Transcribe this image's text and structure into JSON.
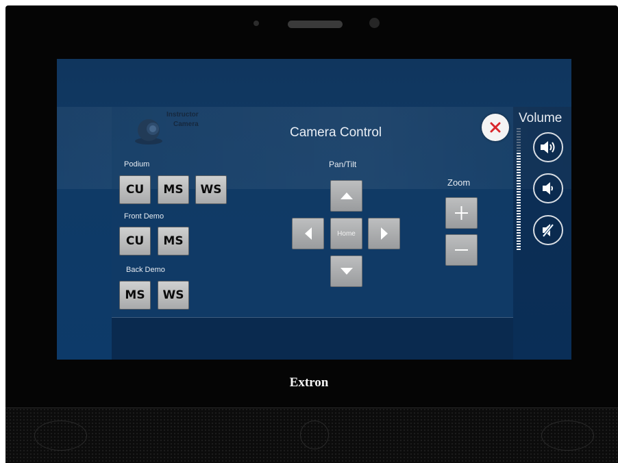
{
  "device": {
    "brand": "Extron"
  },
  "screen": {
    "title": "Camera Control",
    "camera_badge": {
      "line1": "Instructor",
      "line2": "Camera"
    },
    "preset_groups": [
      {
        "label": "Podium",
        "buttons": [
          "CU",
          "MS",
          "WS"
        ]
      },
      {
        "label": "Front Demo",
        "buttons": [
          "CU",
          "MS"
        ]
      },
      {
        "label": "Back Demo",
        "buttons": [
          "MS",
          "WS"
        ]
      }
    ],
    "pan_tilt": {
      "label": "Pan/Tilt",
      "home_label": "Home"
    },
    "zoom": {
      "label": "Zoom"
    },
    "volume": {
      "label": "Volume",
      "level_fraction": 0.8
    }
  },
  "colors": {
    "screen_bg": "#0f3a66",
    "button_face": "#bdbebf",
    "close_x": "#d9262b"
  },
  "icons": {
    "close": "close-icon",
    "up": "arrow-up-icon",
    "down": "arrow-down-icon",
    "left": "arrow-left-icon",
    "right": "arrow-right-icon",
    "plus": "plus-icon",
    "minus": "minus-icon",
    "vol_up": "volume-up-icon",
    "vol_down": "volume-down-icon",
    "mute": "mute-icon"
  }
}
